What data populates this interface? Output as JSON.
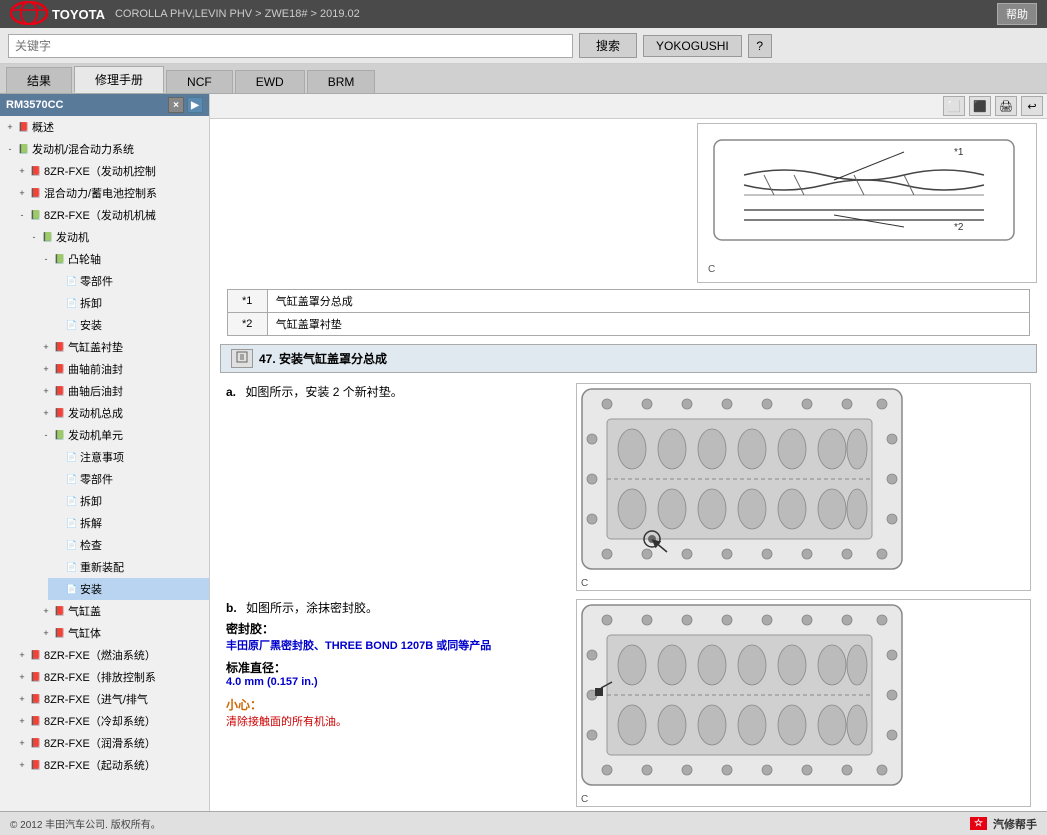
{
  "topbar": {
    "logo_text": "TOYOTA",
    "breadcrumb": "COROLLA PHV,LEVIN PHV > ZWE18# > 2019.02",
    "help_label": "帮助"
  },
  "searchbar": {
    "input_placeholder": "关键字",
    "search_label": "搜索",
    "yokogushi_label": "YOKOGUSHI",
    "question_label": "?"
  },
  "tabs": [
    {
      "id": "results",
      "label": "结果",
      "active": false
    },
    {
      "id": "repair",
      "label": "修理手册",
      "active": true
    },
    {
      "id": "ncf",
      "label": "NCF",
      "active": false
    },
    {
      "id": "ewd",
      "label": "EWD",
      "active": false
    },
    {
      "id": "brm",
      "label": "BRM",
      "active": false
    }
  ],
  "sidebar": {
    "header_id": "RM3570CC",
    "tree": [
      {
        "level": 0,
        "expand": "+",
        "icon": "book",
        "label": "概述",
        "indent": 0
      },
      {
        "level": 0,
        "expand": "-",
        "icon": "book",
        "label": "发动机/混合动力系统",
        "indent": 0
      },
      {
        "level": 1,
        "expand": "+",
        "icon": "book",
        "label": "8ZR-FXE（发动机控制",
        "indent": 1
      },
      {
        "level": 1,
        "expand": "+",
        "icon": "book",
        "label": "混合动力/蓄电池控制系",
        "indent": 1
      },
      {
        "level": 1,
        "expand": "-",
        "icon": "book",
        "label": "8ZR-FXE（发动机机械",
        "indent": 1
      },
      {
        "level": 2,
        "expand": "-",
        "icon": "book",
        "label": "发动机",
        "indent": 2
      },
      {
        "level": 3,
        "expand": "-",
        "icon": "book",
        "label": "凸轮轴",
        "indent": 3
      },
      {
        "level": 4,
        "expand": "",
        "icon": "page",
        "label": "零部件",
        "indent": 4
      },
      {
        "level": 4,
        "expand": "",
        "icon": "page",
        "label": "拆卸",
        "indent": 4
      },
      {
        "level": 4,
        "expand": "",
        "icon": "page",
        "label": "安装",
        "indent": 4
      },
      {
        "level": 3,
        "expand": "+",
        "icon": "book",
        "label": "气缸盖衬垫",
        "indent": 3
      },
      {
        "level": 3,
        "expand": "+",
        "icon": "book",
        "label": "曲轴前油封",
        "indent": 3
      },
      {
        "level": 3,
        "expand": "+",
        "icon": "book",
        "label": "曲轴后油封",
        "indent": 3
      },
      {
        "level": 3,
        "expand": "+",
        "icon": "book",
        "label": "发动机总成",
        "indent": 3
      },
      {
        "level": 3,
        "expand": "-",
        "icon": "book",
        "label": "发动机单元",
        "indent": 3
      },
      {
        "level": 4,
        "expand": "",
        "icon": "page",
        "label": "注意事项",
        "indent": 4
      },
      {
        "level": 4,
        "expand": "",
        "icon": "page",
        "label": "零部件",
        "indent": 4
      },
      {
        "level": 4,
        "expand": "",
        "icon": "page",
        "label": "拆卸",
        "indent": 4
      },
      {
        "level": 4,
        "expand": "",
        "icon": "page",
        "label": "拆解",
        "indent": 4
      },
      {
        "level": 4,
        "expand": "",
        "icon": "page",
        "label": "检查",
        "indent": 4
      },
      {
        "level": 4,
        "expand": "",
        "icon": "page",
        "label": "重新装配",
        "indent": 4
      },
      {
        "level": 4,
        "expand": "",
        "icon": "page",
        "label": "安装",
        "indent": 4
      },
      {
        "level": 3,
        "expand": "+",
        "icon": "book",
        "label": "气缸盖",
        "indent": 3
      },
      {
        "level": 3,
        "expand": "+",
        "icon": "book",
        "label": "气缸体",
        "indent": 3
      },
      {
        "level": 1,
        "expand": "+",
        "icon": "book",
        "label": "8ZR-FXE（燃油系统）",
        "indent": 1
      },
      {
        "level": 1,
        "expand": "+",
        "icon": "book",
        "label": "8ZR-FXE（排放控制系",
        "indent": 1
      },
      {
        "level": 1,
        "expand": "+",
        "icon": "book",
        "label": "8ZR-FXE（进气/排气",
        "indent": 1
      },
      {
        "level": 1,
        "expand": "+",
        "icon": "book",
        "label": "8ZR-FXE（冷却系统）",
        "indent": 1
      },
      {
        "level": 1,
        "expand": "+",
        "icon": "book",
        "label": "8ZR-FXE（润滑系统）",
        "indent": 1
      },
      {
        "level": 1,
        "expand": "+",
        "icon": "book",
        "label": "8ZR-FXE（起动系统）",
        "indent": 1
      }
    ]
  },
  "content": {
    "toolbar_buttons": [
      "⬜",
      "⬜",
      "⬛",
      "↩"
    ],
    "ref_table": [
      {
        "ref": "*1",
        "desc": "气缸盖罩分总成"
      },
      {
        "ref": "*2",
        "desc": "气缸盖罩衬垫"
      }
    ],
    "step47": {
      "number": "47",
      "title": "安装气缸盖罩分总成",
      "step_a": {
        "label": "a.",
        "text": "如图所示，安装 2 个新衬垫。"
      },
      "step_b": {
        "label": "b.",
        "text": "如图所示，涂抹密封胶。",
        "sealant_label": "密封胶：",
        "sealant_value": "丰田原厂黑密封胶、THREE BOND 1207B 或同等产品",
        "diameter_label": "标准直径：",
        "diameter_value": "4.0 mm (0.157 in.)",
        "caution_label": "小心：",
        "caution_text": "清除接触面的所有机油。"
      }
    }
  },
  "footer": {
    "copyright": "© 2012 丰田汽车公司. 版权所有。",
    "logo_text": "汽修帮手"
  }
}
